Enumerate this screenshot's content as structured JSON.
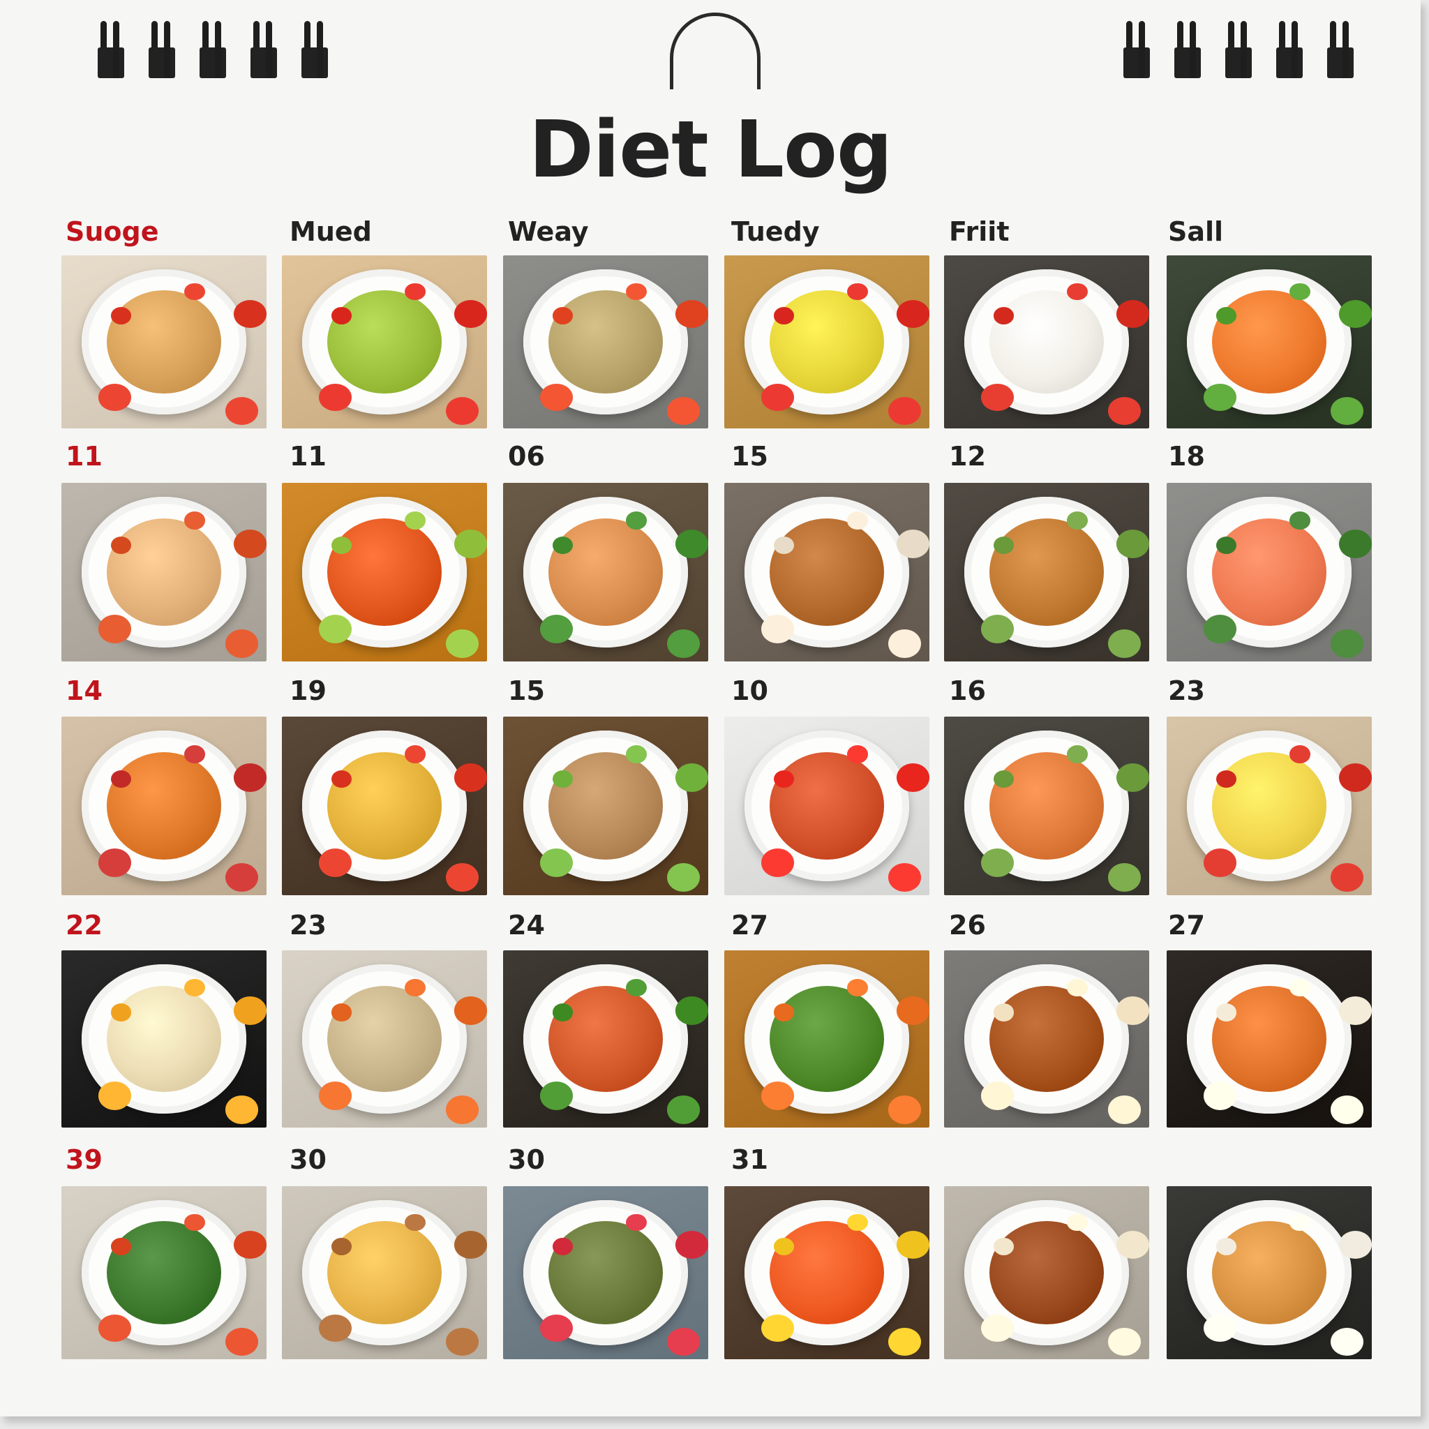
{
  "title": "Diet Log",
  "day_labels": [
    "Suoge",
    "Mued",
    "Weay",
    "Tuedy",
    "Friit",
    "Sall"
  ],
  "week_dates": [
    [
      "11",
      "11",
      "06",
      "15",
      "12",
      "18"
    ],
    [
      "14",
      "19",
      "15",
      "10",
      "16",
      "23"
    ],
    [
      "22",
      "23",
      "24",
      "27",
      "26",
      "27"
    ],
    [
      "39",
      "30",
      "30",
      "31",
      "",
      ""
    ]
  ],
  "rows": [
    [
      {
        "photo": "sandwich-stack-photo",
        "bg": "#e8dccb",
        "food": "#d9a25a",
        "accent": "#d8321e"
      },
      {
        "photo": "salad-bowl-photo",
        "bg": "#e2c49a",
        "food": "#9cbf3c",
        "accent": "#d9261c"
      },
      {
        "photo": "grain-salad-photo",
        "bg": "#8e8e8a",
        "food": "#b8a46a",
        "accent": "#e0421f"
      },
      {
        "photo": "fruit-bowl-photo",
        "bg": "#c99a4e",
        "food": "#e7d63a",
        "accent": "#d8261e"
      },
      {
        "photo": "caprese-plate-photo",
        "bg": "#4d4a45",
        "food": "#f2f0e8",
        "accent": "#d42a1e"
      },
      {
        "photo": "salmon-on-lettuce-photo",
        "bg": "#3f4a3a",
        "food": "#ef7a2e",
        "accent": "#4e9a2a"
      }
    ],
    [
      {
        "photo": "stacked-pancakes-photo",
        "bg": "#bdb7ad",
        "food": "#e3b27a",
        "accent": "#d4491e"
      },
      {
        "photo": "fried-fruit-bowl-photo",
        "bg": "#d28a2a",
        "food": "#e2571e",
        "accent": "#8fbf3a"
      },
      {
        "photo": "chicken-bowl-photo",
        "bg": "#6a5a48",
        "food": "#d98d4e",
        "accent": "#3f8a2a"
      },
      {
        "photo": "croissants-photo",
        "bg": "#7a7066",
        "food": "#b46a2c",
        "accent": "#e8dcc8"
      },
      {
        "photo": "nut-pastry-plate-photo",
        "bg": "#514b44",
        "food": "#c27a32",
        "accent": "#6a9a3a"
      },
      {
        "photo": "salmon-slices-photo",
        "bg": "#8f8f8c",
        "food": "#f07a52",
        "accent": "#3a7a2a"
      }
    ],
    [
      {
        "photo": "veggie-salad-bowl-photo",
        "bg": "#d6c2a8",
        "food": "#e07a2a",
        "accent": "#c22a28"
      },
      {
        "photo": "bean-bowl-photo",
        "bg": "#5a4838",
        "food": "#e4b23a",
        "accent": "#d8321e"
      },
      {
        "photo": "lentil-salad-photo",
        "bg": "#6e5236",
        "food": "#b88a5a",
        "accent": "#6fb13a"
      },
      {
        "photo": "shrimp-stirfry-photo",
        "bg": "#ededeb",
        "food": "#d2502a",
        "accent": "#e8261e"
      },
      {
        "photo": "skewers-plate-photo",
        "bg": "#4e4a44",
        "food": "#e07a3a",
        "accent": "#6a9a3a"
      },
      {
        "photo": "mini-tarts-photo",
        "bg": "#d8c4a6",
        "food": "#f2d64e",
        "accent": "#d02a1e"
      }
    ],
    [
      {
        "photo": "burrata-plate-photo",
        "bg": "#2a2a2a",
        "food": "#ecdcb4",
        "accent": "#f0a21e"
      },
      {
        "photo": "rice-pilaf-photo",
        "bg": "#d9d2c6",
        "food": "#c8b48a",
        "accent": "#e2621e"
      },
      {
        "photo": "fried-fritters-photo",
        "bg": "#3f3a34",
        "food": "#d2582a",
        "accent": "#3e8a22"
      },
      {
        "photo": "arugula-salad-photo",
        "bg": "#c08032",
        "food": "#4e8a2a",
        "accent": "#e86a1e"
      },
      {
        "photo": "glazed-burger-photo",
        "bg": "#7e7c78",
        "food": "#a8521e",
        "accent": "#f2e2c2"
      },
      {
        "photo": "churros-plate-photo",
        "bg": "#2f2a26",
        "food": "#e0722a",
        "accent": "#f4ecd8"
      }
    ],
    [
      {
        "photo": "mezze-spread-photo",
        "bg": "#d8d2c6",
        "food": "#3e7a2e",
        "accent": "#d8421e"
      },
      {
        "photo": "crackers-bowl-photo",
        "bg": "#cfc8bc",
        "food": "#e8b44a",
        "accent": "#a8642e"
      },
      {
        "photo": "lentils-bowls-photo",
        "bg": "#7c8a94",
        "food": "#6a7a3a",
        "accent": "#d22a3a"
      },
      {
        "photo": "tomato-bowl-photo",
        "bg": "#5e4a3a",
        "food": "#ef5a22",
        "accent": "#f0c21e"
      },
      {
        "photo": "pizza-burger-photo",
        "bg": "#bfb8ac",
        "food": "#9a4a1e",
        "accent": "#f2e6cc"
      },
      {
        "photo": "stuffed-pastries-photo",
        "bg": "#3a3a36",
        "food": "#d89242",
        "accent": "#f2ece0"
      }
    ]
  ]
}
